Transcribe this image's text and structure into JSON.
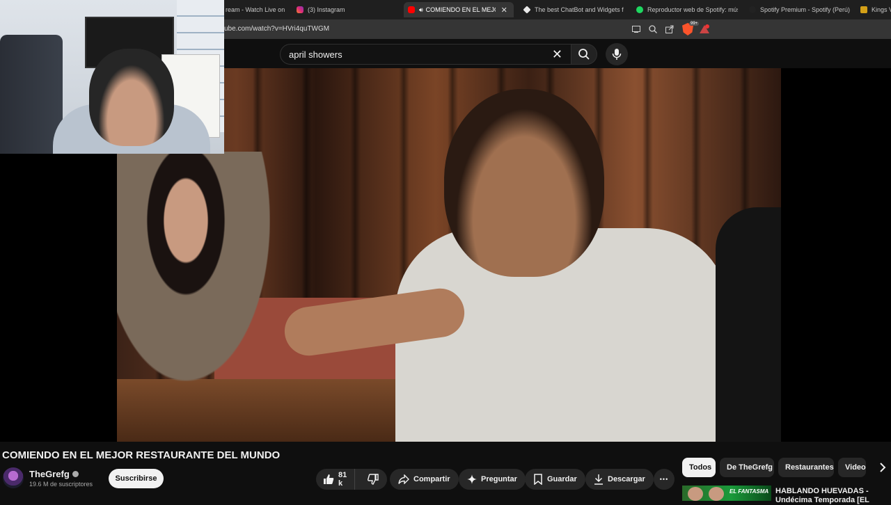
{
  "browser": {
    "tabs": [
      {
        "label": "ream - Watch Live on",
        "active": false
      },
      {
        "label": "(3) Instagram",
        "active": false,
        "icon": "instagram-icon"
      },
      {
        "label": "COMIENDO EN EL MEJOR R",
        "active": true,
        "icon": "youtube-icon"
      },
      {
        "label": "The best ChatBot and Widgets for",
        "active": false,
        "icon": "diamond-icon"
      },
      {
        "label": "Reproductor web de Spotify: músi",
        "active": false,
        "icon": "spotify-icon"
      },
      {
        "label": "Spotify Premium - Spotify (Perú)",
        "active": false,
        "icon": "spotify-icon"
      },
      {
        "label": "Kings V",
        "active": false,
        "icon": "crown-icon"
      }
    ],
    "url": "ube.com/watch?v=HVri4quTWGM",
    "extension_badge": "99+",
    "colors": {
      "brave": "#fb542b",
      "spotify": "#1ed760",
      "youtube": "#ff0000",
      "instagram": "#e1306c"
    }
  },
  "youtube": {
    "search": {
      "query": "april showers"
    },
    "video": {
      "title": "COMIENDO EN EL MEJOR RESTAURANTE DEL MUNDO"
    },
    "channel": {
      "name": "TheGrefg",
      "subscribers": "19.6 M de suscriptores",
      "subscribe_label": "Suscribirse"
    },
    "actions": {
      "likes": "81 k",
      "share": "Compartir",
      "ask": "Preguntar",
      "save": "Guardar",
      "download": "Descargar",
      "more": "•••"
    },
    "chips": [
      "Todos",
      "De TheGrefg",
      "Restaurantes",
      "Videos"
    ],
    "recommended": [
      {
        "title": "HABLANDO HUEVADAS - Undécima Temporada [EL",
        "thumb_text": "EL FANTASMA"
      }
    ]
  }
}
